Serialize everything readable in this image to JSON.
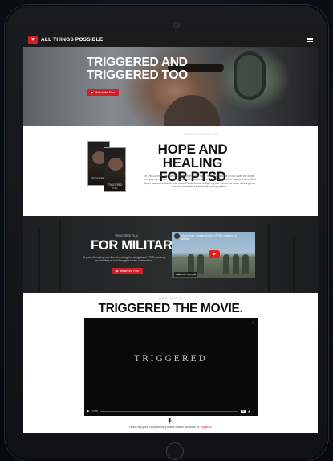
{
  "nav": {
    "brand": "ALL THINGS POSSIBLE",
    "logo_icon": "heart-shield-icon",
    "menu_icon": "hamburger-menu-icon"
  },
  "hero": {
    "title_line1": "TRIGGERED AND",
    "title_line2": "TRIGGERED TOO",
    "button_label": "Watch the Film"
  },
  "ptsd": {
    "kicker": "UNDERSTANDING PTSD",
    "title": "HOPE AND HEALING FOR PTSD",
    "paragraph": "In TRIGGERED, renowned trauma expert Victor Marx, himself a victim of PTSD, takes the viewer on a journey of hope, uncovering causes, symptoms and treatment options for trauma victims. Shot direct, raw and authentic interviews of victims and medical experts reveal how those suffering from trauma can be freed from its life-crushing effects.",
    "dvd1_label": "TRIGGERED",
    "dvd2_label": "TRIGGERED TOO"
  },
  "military": {
    "kicker": "TRIGGERED FILM",
    "title": "FOR MILITARY",
    "paragraph": "A groundbreaking new film chronicling the struggles of PTSD recovery and healing as told through a series of interviews.",
    "button_label": "Watch the Film",
    "video_title": "Victor Marx Triggered Film | PTSD Healing for Military",
    "watch_on": "Watch on YouTube"
  },
  "movie": {
    "kicker": "WATCH THE MOVIE",
    "title": "TRIGGERED THE MOVIE",
    "player_wordmark": "TRIGGERED",
    "time": "0:00",
    "caption_prefix": "Please enjoy the complimentary Arabic subtitle download for ",
    "caption_link": "Triggered."
  },
  "colors": {
    "accent": "#d21f27",
    "nav_bg": "#1b1b1b",
    "dark_section": "#2b2d2e"
  }
}
